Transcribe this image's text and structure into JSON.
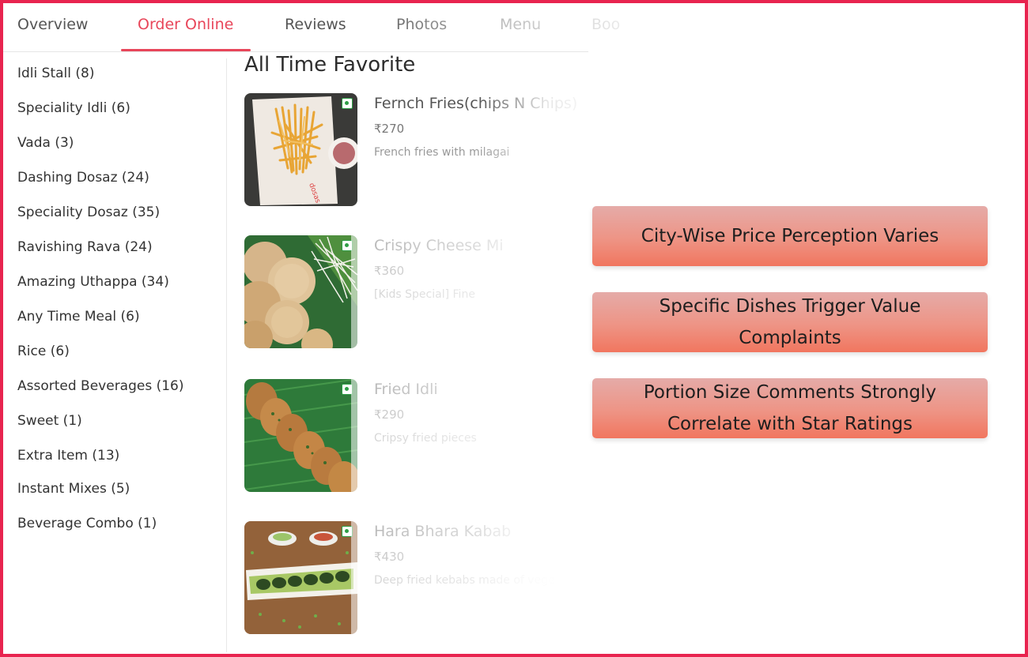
{
  "tabs": [
    {
      "label": "Overview",
      "active": false
    },
    {
      "label": "Order Online",
      "active": true
    },
    {
      "label": "Reviews",
      "active": false
    },
    {
      "label": "Photos",
      "active": false
    },
    {
      "label": "Menu",
      "active": false
    },
    {
      "label": "Boo",
      "active": false
    }
  ],
  "sidebar": {
    "categories": [
      "Idli Stall (8)",
      "Speciality Idli (6)",
      "Vada (3)",
      "Dashing Dosaz (24)",
      "Speciality Dosaz (35)",
      "Ravishing Rava (24)",
      "Amazing Uthappa (34)",
      "Any Time Meal (6)",
      "Rice (6)",
      "Assorted Beverages (16)",
      "Sweet (1)",
      "Extra Item (13)",
      "Instant Mixes (5)",
      "Beverage Combo (1)"
    ]
  },
  "main": {
    "section_title": "All Time Favorite",
    "dishes": [
      {
        "name": "Fernch Fries(chips N Chips)",
        "price": "₹270",
        "description": "French fries with milagai"
      },
      {
        "name": "Crispy Cheese Mi",
        "price": "₹360",
        "description": "[Kids Special] Fine"
      },
      {
        "name": "Fried Idli",
        "price": "₹290",
        "description": "Cripsy fried pieces"
      },
      {
        "name": "Hara Bhara Kabab",
        "price": "₹430",
        "description": "Deep fried kebabs made of vege"
      }
    ]
  },
  "callouts": [
    "City-Wise Price Perception Varies",
    "Specific Dishes Trigger Value Complaints",
    "Portion Size Comments Strongly Correlate with Star Ratings"
  ],
  "colors": {
    "frame_border": "#e8244f",
    "active_tab": "#e8465a",
    "callout_bottom": "#f1765f",
    "veg_mark": "#2e9e45"
  }
}
